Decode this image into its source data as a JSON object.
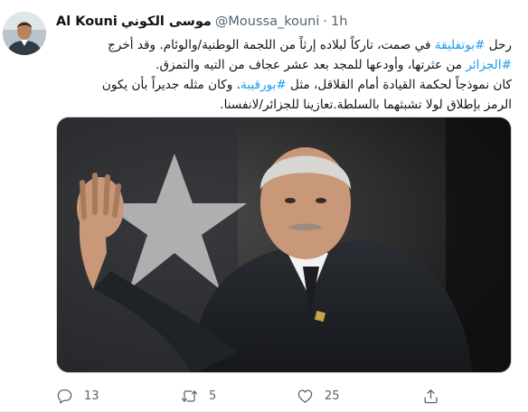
{
  "tweet": {
    "author_name": "Al Kouni",
    "author_name_arabic": "موسى الكوني",
    "handle": "@Moussa_kouni",
    "separator": "·",
    "time": "1h",
    "lines": [
      [
        {
          "text": "رحل "
        },
        {
          "text": "#بوتفليقة",
          "hashtag": true
        },
        {
          "text": " في صمت، تاركاً لبلاده إرثاً من اللجمة الوطنية/والوئام. وقد أخرج"
        }
      ],
      [
        {
          "text": "#الجزائر",
          "hashtag": true
        },
        {
          "text": " من عثرتها، وأودعها للمجد بعد عشر عجاف من التيه والتمزق."
        }
      ],
      [
        {
          "text": "كان نموذجاً لحكمة القيادة أمام القلاقل، مثل "
        },
        {
          "text": "#بورقيبة",
          "hashtag": true
        },
        {
          "text": ". وكان مثله جديراً بأن يكون"
        }
      ],
      [
        {
          "text": "الرمز بإطلاق لولا تشبثهما بالسلطة.تعازينا للجزائر/لانفسنا."
        }
      ]
    ]
  },
  "actions": {
    "reply_count": "13",
    "retweet_count": "5",
    "like_count": "25",
    "share_count": ""
  },
  "icons": {
    "reply": "reply-icon",
    "retweet": "retweet-icon",
    "like": "heart-icon",
    "share": "share-icon"
  },
  "colors": {
    "hashtag": "#1d9bf0",
    "text": "#0f1419",
    "secondary": "#536471"
  }
}
